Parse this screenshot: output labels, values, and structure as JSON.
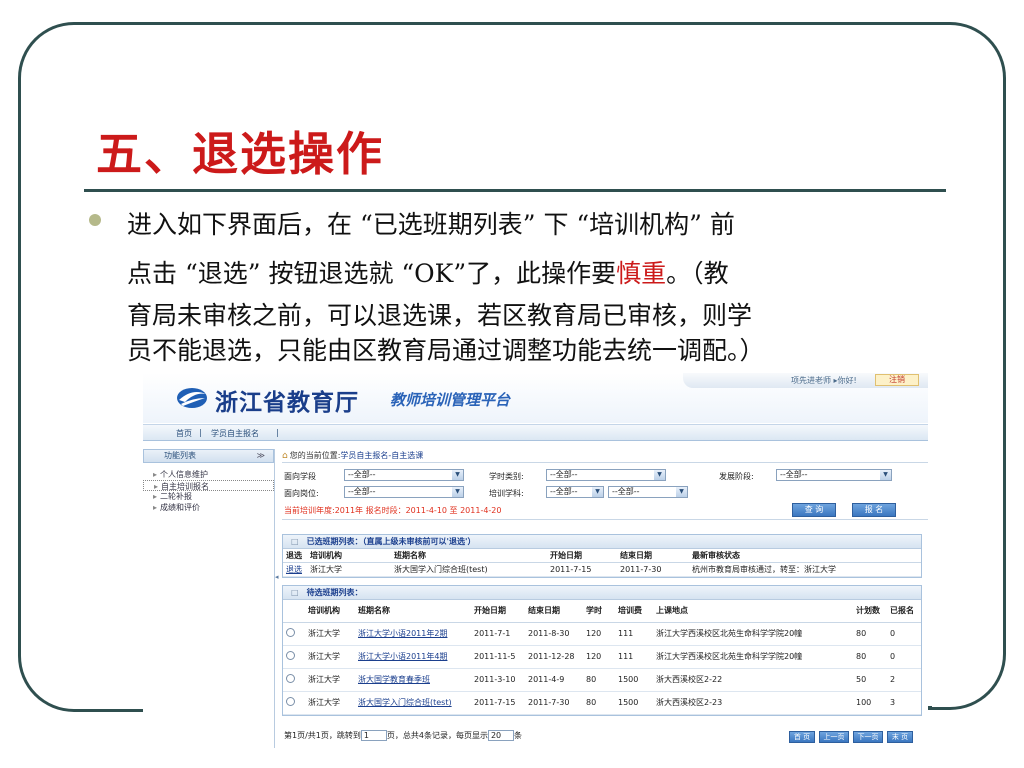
{
  "slide": {
    "title": "五、退选操作",
    "bullet": {
      "line1": "进入如下界面后，在 “已选班期列表” 下 “培训机构” 前",
      "line2_a": "点击 “退选” 按钮退选就 “OK”了，此操作要",
      "line2_em": "慎重",
      "line2_b": "。（教",
      "line3": "育局未审核之前，可以退选课，若区教育局已审核，则学",
      "line4": "员不能退选，只能由区教育局通过调整功能去统一调配。）"
    },
    "accent_color": "#cc1a1a"
  },
  "app": {
    "logo_text": "浙江省教育厅",
    "logo_sub": "教师培训管理平台",
    "user_greeting": "项先进老师 ▸你好!",
    "logout_label": "注销",
    "nav": {
      "home": "首页",
      "sep": "|",
      "enroll": "学员自主报名",
      "sep2": "|"
    },
    "sidebar": {
      "header": "功能列表",
      "collapse_glyph": "≫",
      "items": [
        {
          "label": "个人信息维护"
        },
        {
          "label": "自主培训报名"
        },
        {
          "label": "二轮补报"
        },
        {
          "label": "成绩和评价"
        }
      ]
    },
    "location": {
      "prefix": "您的当前位置:",
      "path": "学员自主报名-自主选课"
    },
    "filters": {
      "stage_label": "面向学段",
      "stage_value": "--全部--",
      "hour_type_label": "学时类别:",
      "hour_type_value": "--全部--",
      "dev_stage_label": "发展阶段:",
      "dev_stage_value": "--全部--",
      "post_label": "面向岗位:",
      "post_value": "--全部--",
      "subject_label": "培训学科:",
      "subject_value1": "--全部--",
      "subject_value2": "--全部--"
    },
    "period": {
      "text": "当前培训年度:2011年    报名时段：2011-4-10 至 2011-4-20",
      "query_label": "查 询",
      "enroll_label": "报 名"
    },
    "selected_panel": {
      "title": "已选班期列表：（直属上级未审核前可以'退选'）",
      "headers": [
        "退选",
        "培训机构",
        "班期名称",
        "开始日期",
        "结束日期",
        "最新审核状态"
      ],
      "rows": [
        {
          "action": "退选",
          "org": "浙江大学",
          "name": "浙大国学入门综合班(test)",
          "start": "2011-7-15",
          "end": "2011-7-30",
          "status": "杭州市教育局审核通过，转至：浙江大学"
        }
      ]
    },
    "pending_panel": {
      "title": "待选班期列表：",
      "headers": [
        "",
        "培训机构",
        "班期名称",
        "开始日期",
        "结束日期",
        "学时",
        "培训费",
        "上课地点",
        "计划数",
        "已报名"
      ],
      "rows": [
        {
          "org": "浙江大学",
          "name": "浙江大学小语2011年2期",
          "start": "2011-7-1",
          "end": "2011-8-30",
          "hours": "120",
          "fee": "111",
          "place": "浙江大学西溪校区北苑生命科学学院20幢",
          "plan": "80",
          "enrolled": "0"
        },
        {
          "org": "浙江大学",
          "name": "浙江大学小语2011年4期",
          "start": "2011-11-5",
          "end": "2011-12-28",
          "hours": "120",
          "fee": "111",
          "place": "浙江大学西溪校区北苑生命科学学院20幢",
          "plan": "80",
          "enrolled": "0"
        },
        {
          "org": "浙江大学",
          "name": "浙大国学教育春季班",
          "start": "2011-3-10",
          "end": "2011-4-9",
          "hours": "80",
          "fee": "1500",
          "place": "浙大西溪校区2-22",
          "plan": "50",
          "enrolled": "2"
        },
        {
          "org": "浙江大学",
          "name": "浙大国学入门综合班(test)",
          "start": "2011-7-15",
          "end": "2011-7-30",
          "hours": "80",
          "fee": "1500",
          "place": "浙大西溪校区2-23",
          "plan": "100",
          "enrolled": "3"
        }
      ]
    },
    "pager": {
      "info_a": "第1页/共1页，跳转到",
      "page_input": "1",
      "info_b": "页，总共4条记录，每页显示",
      "size_input": "20",
      "info_c": "条",
      "first": "首 页",
      "prev": "上一页",
      "next": "下一页",
      "last": "末 页"
    }
  }
}
